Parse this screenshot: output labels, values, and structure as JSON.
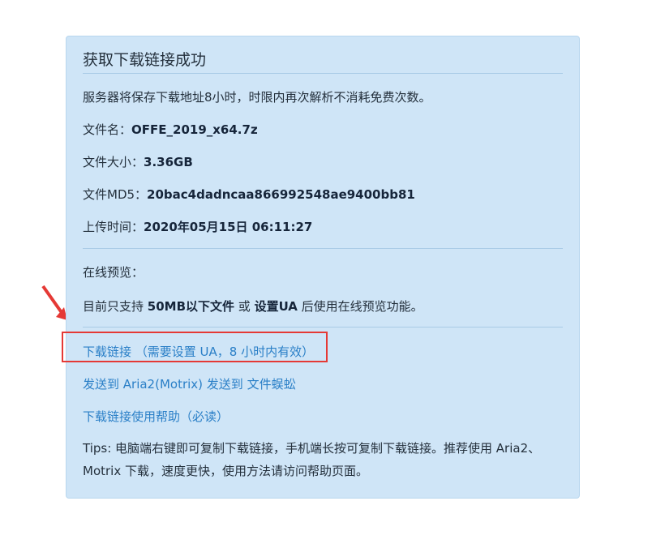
{
  "card": {
    "title": "获取下载链接成功",
    "notice": "服务器将保存下载地址8小时，时限内再次解析不消耗免费次数。",
    "file_name_label": "文件名：",
    "file_name_value": "OFFE_2019_x64.7z",
    "file_size_label": "文件大小：",
    "file_size_value": "3.36GB",
    "md5_label": "文件MD5：",
    "md5_value": "20bac4dadncaa866992548ae9400bb81",
    "upload_label": "上传时间：",
    "upload_value": "2020年05月15日 06:11:27",
    "preview_label": "在线预览：",
    "preview_prefix": "目前只支持 ",
    "preview_bold1": "50MB以下文件",
    "preview_mid": " 或 ",
    "preview_bold2": "设置UA",
    "preview_suffix": " 后使用在线预览功能。",
    "download_link": "下载链接 （需要设置 UA，8 小时内有效）",
    "send_aria2": "发送到 Aria2(Motrix)",
    "send_centipede": "发送到 文件蜈蚣",
    "help_link": "下载链接使用帮助（必读）",
    "tips": "Tips: 电脑端右键即可复制下载链接，手机端长按可复制下载链接。推荐使用 Aria2、Motrix 下载，速度更快，使用方法请访问帮助页面。"
  },
  "colors": {
    "card_bg": "#cfe5f7",
    "link": "#2a7fc7",
    "highlight": "#e53935"
  }
}
